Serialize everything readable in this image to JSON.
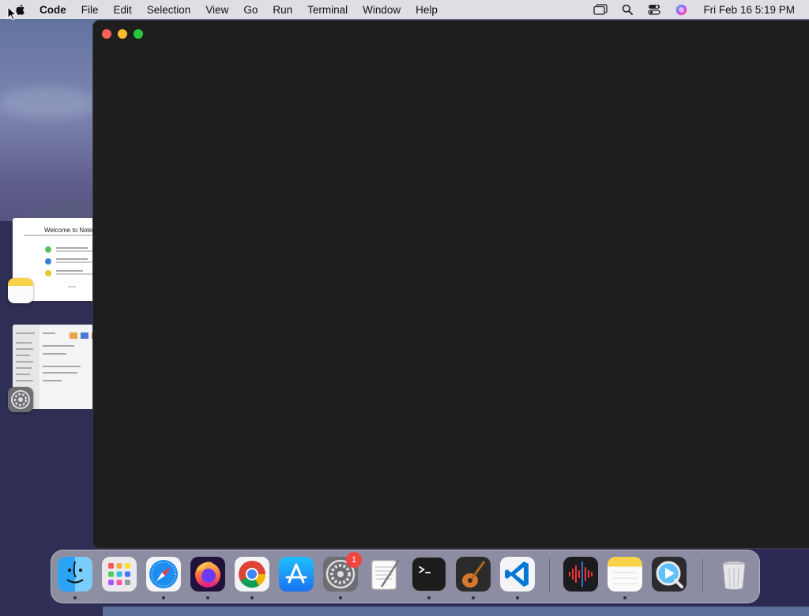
{
  "menubar": {
    "app_name": "Code",
    "items": [
      "File",
      "Edit",
      "Selection",
      "View",
      "Go",
      "Run",
      "Terminal",
      "Window",
      "Help"
    ],
    "clock": "Fri Feb 16  5:19 PM",
    "status_icons": [
      "stage-manager-icon",
      "search-icon",
      "control-center-icon",
      "siri-icon"
    ]
  },
  "window": {
    "background": "#1e1e1e",
    "buttons": [
      "close",
      "minimize",
      "maximize"
    ]
  },
  "stage_manager": {
    "notes_thumbnail": {
      "title": "Welcome to Notes"
    },
    "settings_thumbnail": {}
  },
  "dock": {
    "apps": [
      "Finder",
      "Launchpad",
      "Safari",
      "Firefox",
      "Chrome",
      "App Store",
      "System Settings",
      "TextEdit",
      "Terminal",
      "GarageBand",
      "Visual Studio Code",
      "Voice Memos",
      "Notes",
      "QuickTime Player",
      "Trash"
    ],
    "settings_badge": "1"
  }
}
